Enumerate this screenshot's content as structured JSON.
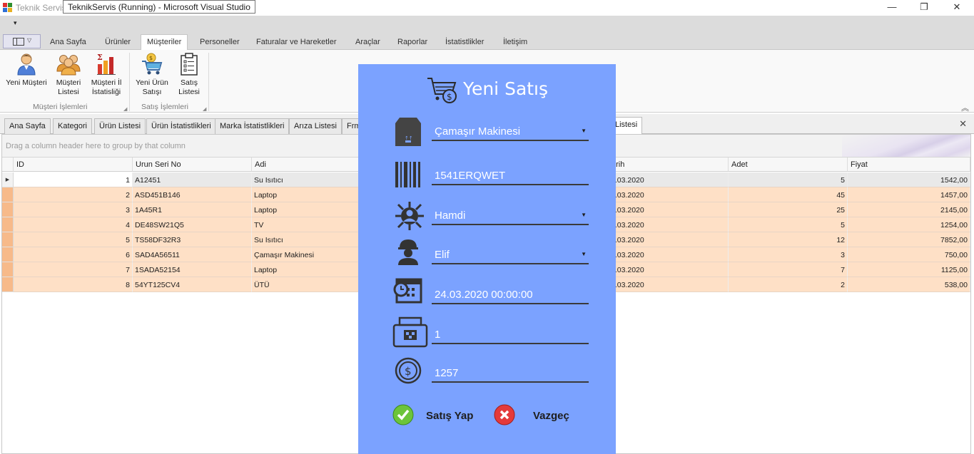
{
  "window": {
    "title": "Teknik Servis",
    "tooltip": "TeknikServis (Running) - Microsoft Visual Studio",
    "controls": {
      "minimize": "—",
      "restore": "❐",
      "close": "✕"
    }
  },
  "qat": {
    "customize_arrow": "▾"
  },
  "ribbon": {
    "tabs": [
      "Ana Sayfa",
      "Ürünler",
      "Müşteriler",
      "Personeller",
      "Faturalar ve Hareketler",
      "Araçlar",
      "Raporlar",
      "İstatistlikler",
      "İletişim"
    ],
    "active_tab": "Müşteriler",
    "groups": [
      {
        "label": "Müşteri İşlemleri",
        "buttons": [
          {
            "label": "Yeni Müşteri",
            "icon": "customer-icon"
          },
          {
            "label": "Müşteri Listesi",
            "icon": "customer-group-icon"
          },
          {
            "label": "Müşteri İl İstatisliği",
            "icon": "bar-chart-icon"
          }
        ]
      },
      {
        "label": "Satış İşlemleri",
        "buttons": [
          {
            "label": "Yeni Ürün Satışı",
            "icon": "shopping-cart-icon"
          },
          {
            "label": "Satış Listesi",
            "icon": "clipboard-list-icon"
          }
        ]
      }
    ],
    "collapse_glyph": "︽"
  },
  "doc_tabs": {
    "items": [
      "Ana Sayfa",
      "Kategori",
      "Ürün Listesi",
      "Ürün İstatistlikleri",
      "Marka İstatistlikleri",
      "Arıza Listesi",
      "Frm"
    ],
    "active": "Listesi",
    "close_glyph": "✕"
  },
  "grid": {
    "group_panel_text": "Drag a column header here to group by that column",
    "columns": [
      "ID",
      "Urun Seri No",
      "Adi",
      "arih",
      "Adet",
      "Fiyat"
    ],
    "row_indicator": "▶",
    "rows": [
      {
        "id": "1",
        "seri": "A12451",
        "adi": "Su Isıtıcı",
        "tarih": "2.03.2020",
        "adet": "5",
        "fiyat": "1542,00"
      },
      {
        "id": "2",
        "seri": "ASD451B146",
        "adi": "Laptop",
        "tarih": "2.03.2020",
        "adet": "45",
        "fiyat": "1457,00"
      },
      {
        "id": "3",
        "seri": "1A45R1",
        "adi": "Laptop",
        "tarih": "2.03.2020",
        "adet": "25",
        "fiyat": "2145,00"
      },
      {
        "id": "4",
        "seri": "DE48SW21Q5",
        "adi": "TV",
        "tarih": "2.03.2020",
        "adet": "5",
        "fiyat": "1254,00"
      },
      {
        "id": "5",
        "seri": "TS58DF32R3",
        "adi": "Su Isıtıcı",
        "tarih": "2.03.2020",
        "adet": "12",
        "fiyat": "7852,00"
      },
      {
        "id": "6",
        "seri": "SAD4A56511",
        "adi": "Çamaşır Makinesi",
        "tarih": "2.03.2020",
        "adet": "3",
        "fiyat": "750,00"
      },
      {
        "id": "7",
        "seri": "1SADA52154",
        "adi": "Laptop",
        "tarih": "2.03.2020",
        "adet": "7",
        "fiyat": "1125,00"
      },
      {
        "id": "8",
        "seri": "54YT125CV4",
        "adi": "ÜTÜ",
        "tarih": "2.03.2020",
        "adet": "2",
        "fiyat": "538,00"
      }
    ]
  },
  "modal": {
    "title": "Yeni Satış",
    "fields": [
      {
        "name": "urun",
        "value": "Çamaşır Makinesi",
        "icon": "product-box-icon",
        "dropdown": true
      },
      {
        "name": "seri_no",
        "value": "1541ERQWET",
        "icon": "barcode-icon",
        "dropdown": false
      },
      {
        "name": "musteri",
        "value": "Hamdi",
        "icon": "customer-network-icon",
        "dropdown": true
      },
      {
        "name": "personel",
        "value": "Elif",
        "icon": "worker-icon",
        "dropdown": true
      },
      {
        "name": "tarih",
        "value": "24.03.2020 00:00:00",
        "icon": "calendar-clock-icon",
        "dropdown": false
      },
      {
        "name": "adet",
        "value": "1",
        "icon": "cash-register-icon",
        "dropdown": false
      },
      {
        "name": "fiyat",
        "value": "1257",
        "icon": "coin-icon",
        "dropdown": false
      }
    ],
    "dropdown_caret": "▼",
    "buttons": {
      "save": "Satış Yap",
      "cancel": "Vazgeç"
    }
  },
  "colors": {
    "modal_bg": "#7ba2ff",
    "row_selected_bg": "#fee0c6",
    "row_indicator_bg": "#f7ba8a",
    "grid_header_bg": "#f7f7f7",
    "ribbon_bg": "#f9f9f9",
    "tab_strip_bg": "#dcdcdc"
  }
}
